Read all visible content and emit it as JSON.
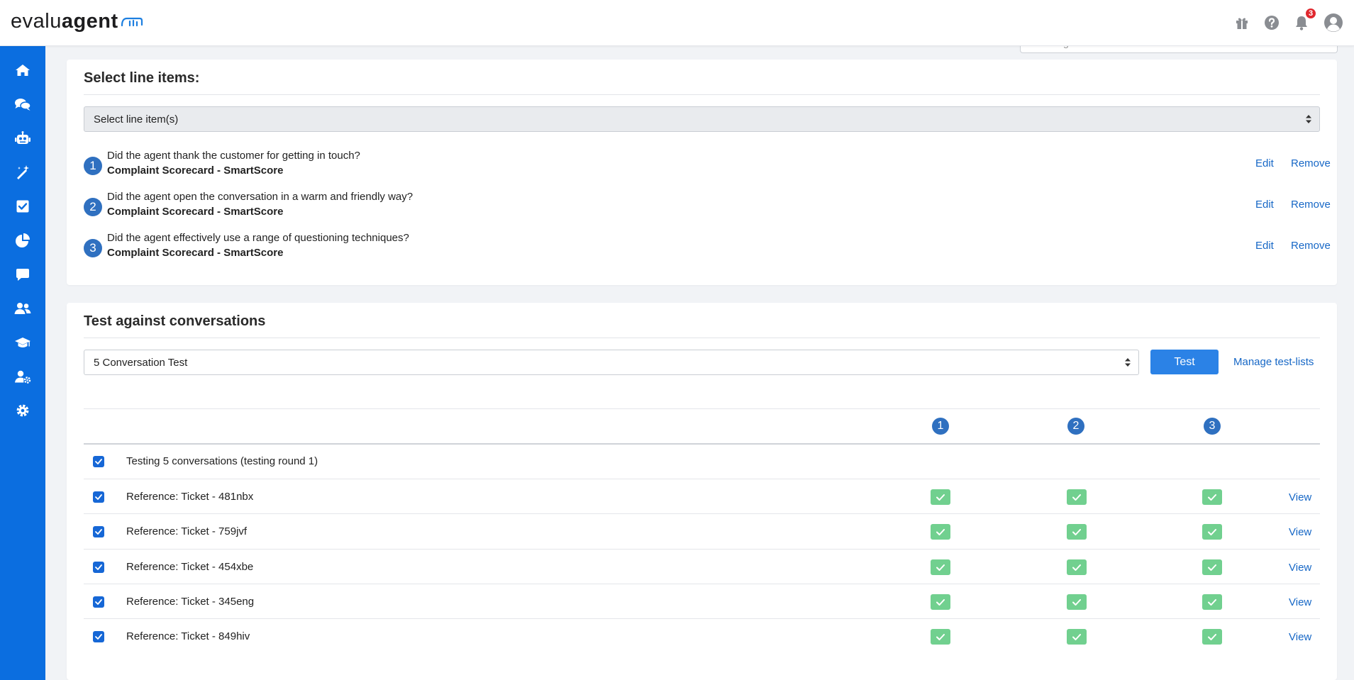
{
  "header": {
    "logo": {
      "part1": "evalu",
      "part2": "agent"
    },
    "notification_count": "3",
    "icons": [
      "gift-icon",
      "help-icon",
      "bell-icon",
      "user-avatar-icon"
    ]
  },
  "sidebar": {
    "items": [
      {
        "name": "home-icon"
      },
      {
        "name": "conversations-icon"
      },
      {
        "name": "robot-icon"
      },
      {
        "name": "magic-wand-icon"
      },
      {
        "name": "checkbox-icon"
      },
      {
        "name": "pie-chart-icon"
      },
      {
        "name": "chat-icon"
      },
      {
        "name": "team-icon"
      },
      {
        "name": "graduation-cap-icon"
      },
      {
        "name": "user-settings-icon"
      },
      {
        "name": "gear-icon"
      }
    ]
  },
  "line_items_section": {
    "title": "Select line items:",
    "select_placeholder": "Select line item(s)",
    "items": [
      {
        "num": "1",
        "question": "Did the agent thank the customer for getting in touch?",
        "scorecard": "Complaint Scorecard - SmartScore",
        "edit": "Edit",
        "remove": "Remove"
      },
      {
        "num": "2",
        "question": "Did the agent open the conversation in a warm and friendly way?",
        "scorecard": "Complaint Scorecard - SmartScore",
        "edit": "Edit",
        "remove": "Remove"
      },
      {
        "num": "3",
        "question": "Did the agent effectively use a range of questioning techniques?",
        "scorecard": "Complaint Scorecard - SmartScore",
        "edit": "Edit",
        "remove": "Remove"
      }
    ]
  },
  "test_section": {
    "title": "Test against conversations",
    "test_list_selected": "5 Conversation Test",
    "test_button": "Test",
    "manage_link": "Manage test-lists",
    "column_headers": [
      "1",
      "2",
      "3"
    ],
    "group_row": {
      "label": "Testing 5 conversations (testing round 1)",
      "checked": true
    },
    "rows": [
      {
        "label": "Reference: Ticket - 481nbx",
        "results": [
          "pass",
          "pass",
          "pass"
        ],
        "view": "View",
        "checked": true
      },
      {
        "label": "Reference: Ticket - 759jvf",
        "results": [
          "pass",
          "pass",
          "pass"
        ],
        "view": "View",
        "checked": true
      },
      {
        "label": "Reference: Ticket - 454xbe",
        "results": [
          "pass",
          "pass",
          "pass"
        ],
        "view": "View",
        "checked": true
      },
      {
        "label": "Reference: Ticket - 345eng",
        "results": [
          "pass",
          "pass",
          "pass"
        ],
        "view": "View",
        "checked": true
      },
      {
        "label": "Reference: Ticket - 849hiv",
        "results": [
          "pass",
          "pass",
          "pass"
        ],
        "view": "View",
        "checked": true
      }
    ]
  },
  "colors": {
    "sidebar": "#0b6ee0",
    "primary_button": "#2b82e6",
    "link": "#1667c6",
    "number_badge": "#2f70c0",
    "pass": "#71d08f",
    "notification": "#e0282e"
  }
}
